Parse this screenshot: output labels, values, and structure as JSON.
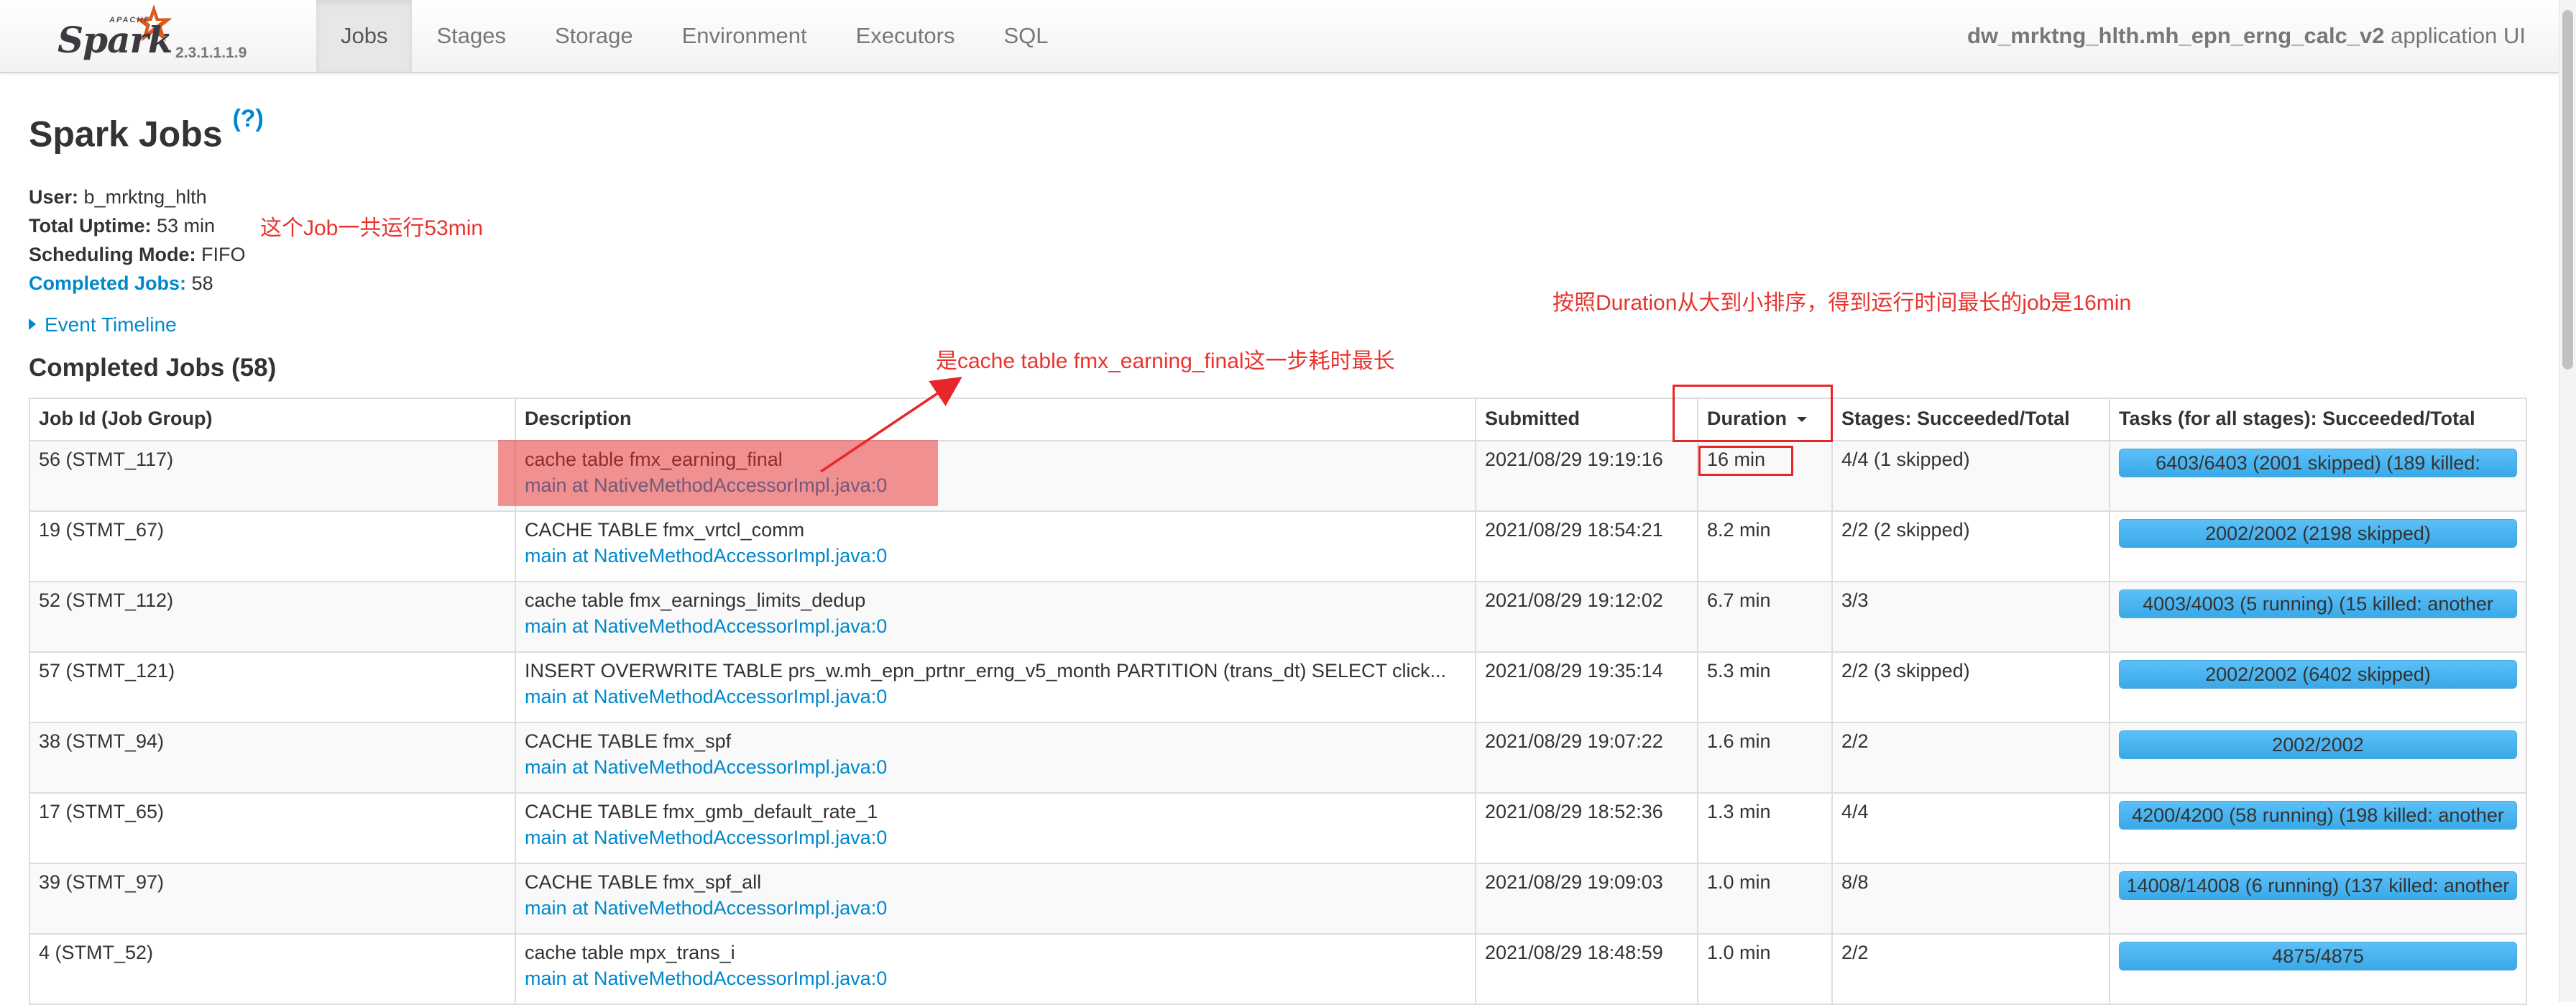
{
  "nav": {
    "brand_apache": "APACHE",
    "brand_name": "Spark",
    "version": "2.3.1.1.1.9",
    "tabs": [
      {
        "label": "Jobs",
        "active": true
      },
      {
        "label": "Stages",
        "active": false
      },
      {
        "label": "Storage",
        "active": false
      },
      {
        "label": "Environment",
        "active": false
      },
      {
        "label": "Executors",
        "active": false
      },
      {
        "label": "SQL",
        "active": false
      }
    ],
    "app_name": "dw_mrktng_hlth.mh_epn_erng_calc_v2",
    "app_suffix": "application UI"
  },
  "header": {
    "title": "Spark Jobs",
    "help": "(?)"
  },
  "summary": {
    "user_label": "User:",
    "user_value": "b_mrktng_hlth",
    "uptime_label": "Total Uptime:",
    "uptime_value": "53 min",
    "scheduling_label": "Scheduling Mode:",
    "scheduling_value": "FIFO",
    "completed_label": "Completed Jobs:",
    "completed_value": "58"
  },
  "timeline": {
    "label": "Event Timeline"
  },
  "completed_section": {
    "title": "Completed Jobs (58)"
  },
  "table": {
    "headers": {
      "job_id": "Job Id (Job Group)",
      "description": "Description",
      "submitted": "Submitted",
      "duration": "Duration",
      "stages": "Stages: Succeeded/Total",
      "tasks": "Tasks (for all stages): Succeeded/Total"
    },
    "rows": [
      {
        "job_id": "56 (STMT_117)",
        "desc": "cache table fmx_earning_final",
        "link": "main at NativeMethodAccessorImpl.java:0",
        "submitted": "2021/08/29 19:19:16",
        "duration": "16 min",
        "stages": "4/4 (1 skipped)",
        "tasks_text": "6403/6403 (2001 skipped) (189 killed:",
        "tasks_progress": 1.0
      },
      {
        "job_id": "19 (STMT_67)",
        "desc": "CACHE TABLE fmx_vrtcl_comm",
        "link": "main at NativeMethodAccessorImpl.java:0",
        "submitted": "2021/08/29 18:54:21",
        "duration": "8.2 min",
        "stages": "2/2 (2 skipped)",
        "tasks_text": "2002/2002 (2198 skipped)",
        "tasks_progress": 1.0
      },
      {
        "job_id": "52 (STMT_112)",
        "desc": "cache table fmx_earnings_limits_dedup",
        "link": "main at NativeMethodAccessorImpl.java:0",
        "submitted": "2021/08/29 19:12:02",
        "duration": "6.7 min",
        "stages": "3/3",
        "tasks_text": "4003/4003 (5 running) (15 killed: another",
        "tasks_progress": 1.0
      },
      {
        "job_id": "57 (STMT_121)",
        "desc": "INSERT OVERWRITE TABLE prs_w.mh_epn_prtnr_erng_v5_month PARTITION (trans_dt) SELECT click...",
        "link": "main at NativeMethodAccessorImpl.java:0",
        "submitted": "2021/08/29 19:35:14",
        "duration": "5.3 min",
        "stages": "2/2 (3 skipped)",
        "tasks_text": "2002/2002 (6402 skipped)",
        "tasks_progress": 1.0
      },
      {
        "job_id": "38 (STMT_94)",
        "desc": "CACHE TABLE fmx_spf",
        "link": "main at NativeMethodAccessorImpl.java:0",
        "submitted": "2021/08/29 19:07:22",
        "duration": "1.6 min",
        "stages": "2/2",
        "tasks_text": "2002/2002",
        "tasks_progress": 1.0
      },
      {
        "job_id": "17 (STMT_65)",
        "desc": "CACHE TABLE fmx_gmb_default_rate_1",
        "link": "main at NativeMethodAccessorImpl.java:0",
        "submitted": "2021/08/29 18:52:36",
        "duration": "1.3 min",
        "stages": "4/4",
        "tasks_text": "4200/4200 (58 running) (198 killed: another",
        "tasks_progress": 1.0
      },
      {
        "job_id": "39 (STMT_97)",
        "desc": "CACHE TABLE fmx_spf_all",
        "link": "main at NativeMethodAccessorImpl.java:0",
        "submitted": "2021/08/29 19:09:03",
        "duration": "1.0 min",
        "stages": "8/8",
        "tasks_text": "14008/14008 (6 running) (137 killed: another",
        "tasks_progress": 1.0
      },
      {
        "job_id": "4 (STMT_52)",
        "desc": "cache table mpx_trans_i",
        "link": "main at NativeMethodAccessorImpl.java:0",
        "submitted": "2021/08/29 18:48:59",
        "duration": "1.0 min",
        "stages": "2/2",
        "tasks_text": "4875/4875",
        "tasks_progress": 1.0
      }
    ]
  },
  "annotations": {
    "uptime_note": "这个Job一共运行53min",
    "sort_note": "按照Duration从大到小排序，得到运行时间最长的job是16min",
    "slowest_note": "是cache table fmx_earning_final这一步耗时最长",
    "color": "#e8332c"
  },
  "colors": {
    "link": "#0088cc",
    "progress_fill": "#3aa9e8",
    "navbar_bg": "#f2f2f2"
  }
}
